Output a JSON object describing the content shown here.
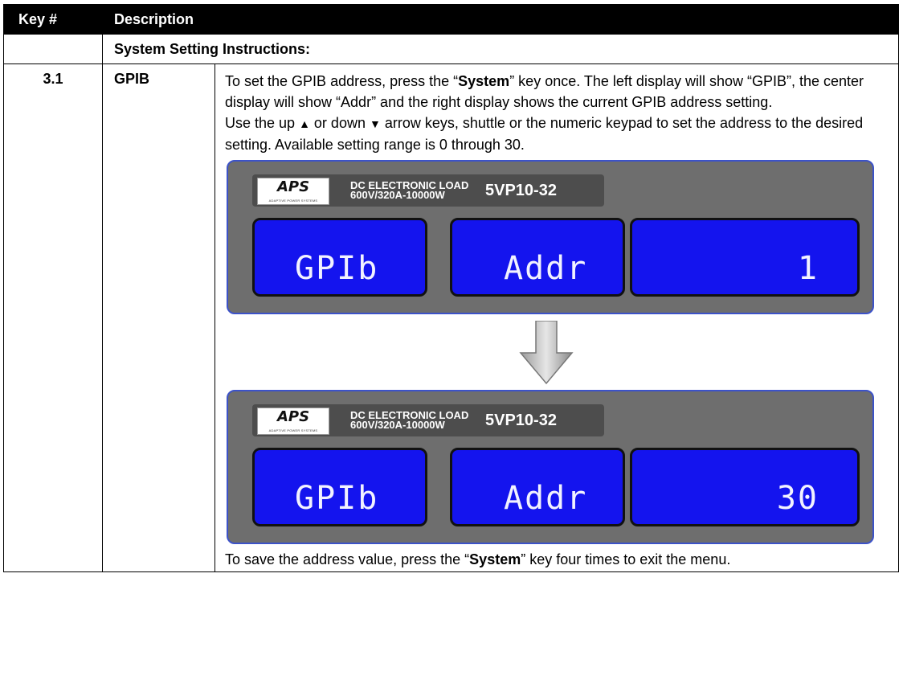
{
  "table": {
    "header": {
      "key_col": "Key #",
      "desc_col": "Description"
    },
    "section_title": "System Setting Instructions:",
    "row": {
      "key": "3.1",
      "name": "GPIB",
      "para1_before": "To set the GPIB address, press the “",
      "para1_bold": "System",
      "para1_after": "” key once. The left display will show “GPIB”, the center display will show “Addr” and the right display shows the current GPIB address setting.",
      "para2_a": "Use the up ",
      "para2_up_glyph": "▲",
      "para2_b": " or down ",
      "para2_down_glyph": "▼",
      "para2_c": " arrow keys, shuttle or the numeric keypad to set the address to the desired setting.  Available setting range is 0 through 30.",
      "para3_before": "To save the address value, press the “",
      "para3_bold": "System",
      "para3_after": "” key four times to exit the menu."
    }
  },
  "panels": [
    {
      "logo": "APS",
      "logo_sub": "ADAPTIVE POWER SYSTEMS",
      "product_line1": "DC ELECTRONIC LOAD",
      "product_line2": "600V/320A-10000W",
      "model": "5VP10-32",
      "display_left": "GPIb",
      "display_center": "Addr",
      "display_right": "1"
    },
    {
      "logo": "APS",
      "logo_sub": "ADAPTIVE POWER SYSTEMS",
      "product_line1": "DC ELECTRONIC LOAD",
      "product_line2": "600V/320A-10000W",
      "model": "5VP10-32",
      "display_left": "GPIb",
      "display_center": "Addr",
      "display_right": "30"
    }
  ],
  "colors": {
    "header_bg": "#000000",
    "panel_bg": "#6e6e6e",
    "panel_border": "#3c52c8",
    "lcd_bg": "#1414ee",
    "arrow_fill": "#c8c8c8"
  },
  "icons": {
    "transition": "down-arrow-icon"
  }
}
